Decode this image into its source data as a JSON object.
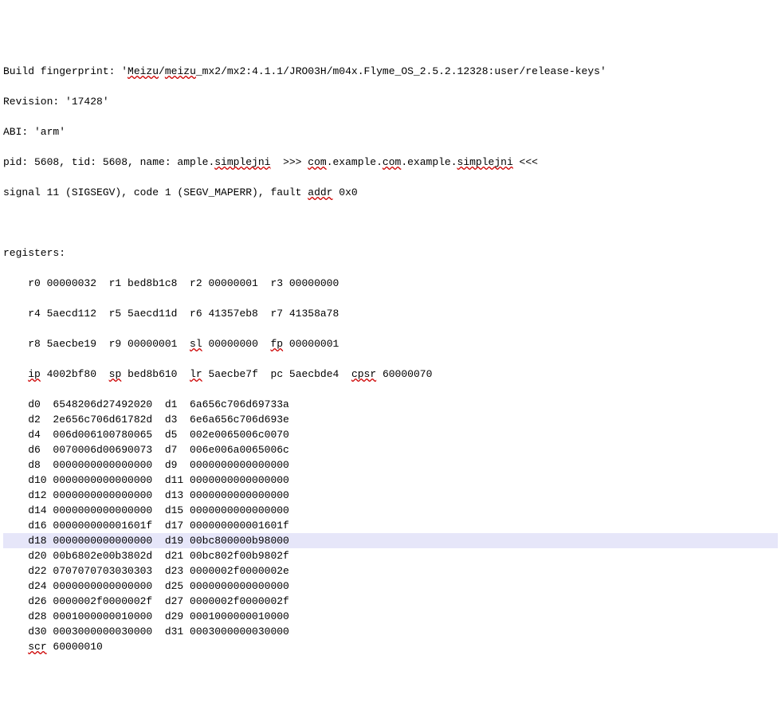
{
  "header": {
    "fingerprint": "Build fingerprint: 'Meizu/meizu_mx2/mx2:4.1.1/JRO03H/m04x.Flyme_OS_2.5.2.12328:user/release-keys'",
    "revision": "Revision: '17428'",
    "abi": "ABI: 'arm'",
    "pid": "pid: 5608, tid: 5608, name: ample.simplejni  >>> com.example.com.example.simplejni <<<",
    "signal": "signal 11 (SIGSEGV), code 1 (SEGV_MAPERR), fault addr 0x0"
  },
  "registers_label": "registers:",
  "gpr": [
    "    r0 00000032  r1 bed8b1c8  r2 00000001  r3 00000000",
    "    r4 5aecd112  r5 5aecd11d  r6 41357eb8  r7 41358a78",
    "    r8 5aecbe19  r9 00000001  sl 00000000  fp 00000001",
    "    ip 4002bf80  sp bed8b610  lr 5aecbe7f  pc 5aecbde4  cpsr 60000070"
  ],
  "dregs": [
    "    d0  6548206d27492020  d1  6a656c706d69733a",
    "    d2  2e656c706d61782d  d3  6e6a656c706d693e",
    "    d4  006d006100780065  d5  002e0065006c0070",
    "    d6  0070006d00690073  d7  006e006a0065006c",
    "    d8  0000000000000000  d9  0000000000000000",
    "    d10 0000000000000000  d11 0000000000000000",
    "    d12 0000000000000000  d13 0000000000000000",
    "    d14 0000000000000000  d15 0000000000000000",
    "    d16 000000000001601f  d17 000000000001601f",
    "    d18 0000000000000000  d19 00bc800000b98000",
    "    d20 00b6802e00b3802d  d21 00bc802f00b9802f",
    "    d22 0707070703030303  d23 0000002f0000002e",
    "    d24 0000000000000000  d25 0000000000000000",
    "    d26 0000002f0000002f  d27 0000002f0000002f",
    "    d28 0001000000010000  d29 0001000000010000",
    "    d30 0003000000030000  d31 0003000000030000",
    "    scr 60000010"
  ],
  "highlight_index": 9
}
